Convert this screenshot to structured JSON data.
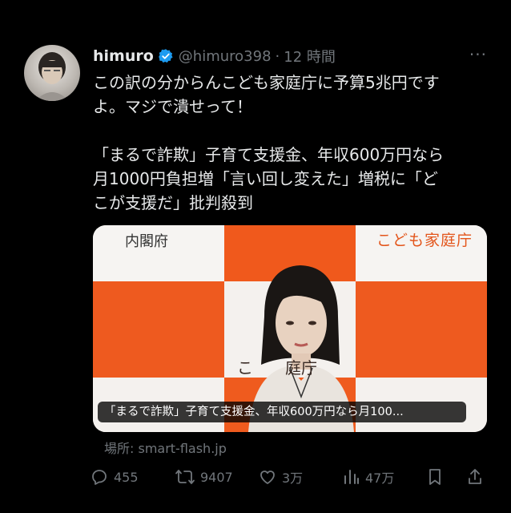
{
  "tweet": {
    "user": {
      "name": "himuro",
      "handle": "@himuro398",
      "separator": "·",
      "time": "12 時間"
    },
    "more_label": "···",
    "body": {
      "line1": "この訳の分からんこども家庭庁に予算5兆円です",
      "line2": "よ。マジで潰せって！",
      "line3": "「まるで詐欺」子育て支援金、年収600万円なら",
      "line4": "月1000円負担増「言い回し変えた」増税に「ど",
      "line5": "こが支援だ」批判殺到"
    }
  },
  "card": {
    "sign_left": "内閣府",
    "sign_right": "こども家庭庁",
    "sign_podium": "こ　　庭庁",
    "caption": "「まるで詐欺」子育て支援金、年収600万円なら月100...",
    "source": "場所: smart-flash.jp",
    "colors": {
      "orange": "#ee5a1f",
      "white": "#f4f1ee"
    }
  },
  "actions": {
    "replies": "455",
    "retweets": "9407",
    "likes": "3万",
    "views": "47万"
  },
  "icons": [
    "verified-badge-icon",
    "more-icon",
    "reply-icon",
    "retweet-icon",
    "like-icon",
    "views-icon",
    "bookmark-icon",
    "share-icon"
  ],
  "theme": {
    "background": "#000000",
    "text": "#e7e9ea",
    "muted": "#71767b",
    "verified": "#1d9bf0"
  }
}
